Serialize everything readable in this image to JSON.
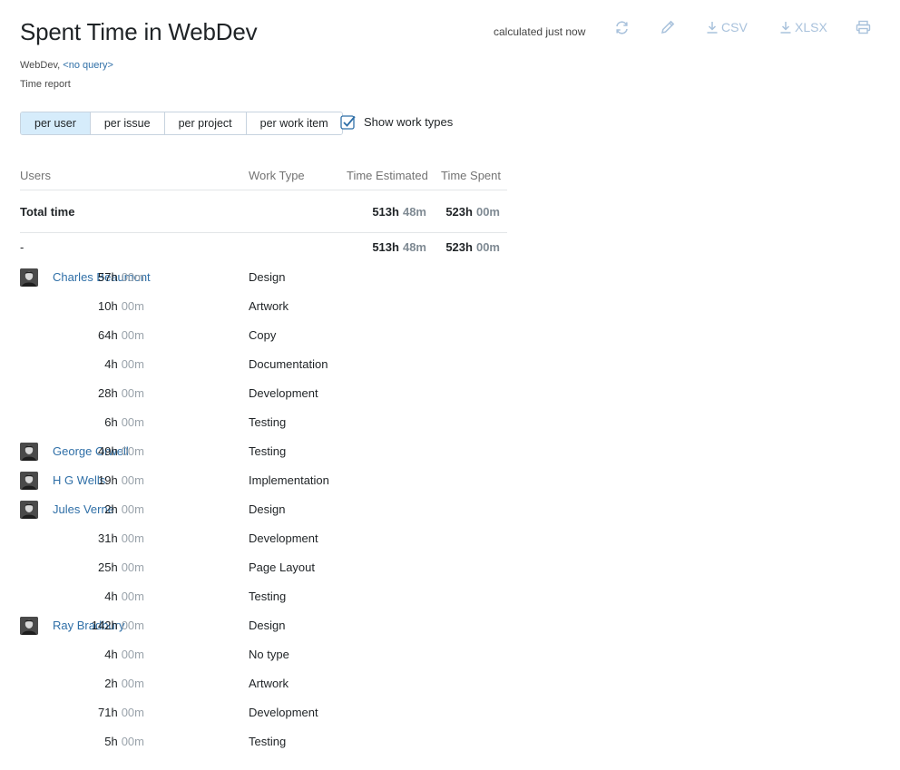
{
  "header": {
    "title": "Spent Time in WebDev",
    "calculated": "calculated just now",
    "csv_label": "CSV",
    "xlsx_label": "XLSX"
  },
  "context": {
    "project": "WebDev,",
    "query_link": "<no query>",
    "report_type": "Time report"
  },
  "grouping": {
    "buttons": [
      "per user",
      "per issue",
      "per project",
      "per work item"
    ],
    "active": "per user",
    "show_work_types_label": "Show work types",
    "show_work_types_checked": true
  },
  "table": {
    "columns": [
      "Users",
      "Work Type",
      "Time Estimated",
      "Time Spent"
    ],
    "total": {
      "label": "Total time",
      "estimated_h": "513h",
      "estimated_m": "48m",
      "spent_h": "523h",
      "spent_m": "00m"
    },
    "group": {
      "label": "-",
      "estimated_h": "513h",
      "estimated_m": "48m",
      "spent_h": "523h",
      "spent_m": "00m"
    },
    "rows": [
      {
        "user": "Charles Beaumont",
        "work_type": "Design",
        "spent_h": "57h",
        "spent_m": "00m"
      },
      {
        "user": "",
        "work_type": "Artwork",
        "spent_h": "10h",
        "spent_m": "00m"
      },
      {
        "user": "",
        "work_type": "Copy",
        "spent_h": "64h",
        "spent_m": "00m"
      },
      {
        "user": "",
        "work_type": "Documentation",
        "spent_h": "4h",
        "spent_m": "00m"
      },
      {
        "user": "",
        "work_type": "Development",
        "spent_h": "28h",
        "spent_m": "00m"
      },
      {
        "user": "",
        "work_type": "Testing",
        "spent_h": "6h",
        "spent_m": "00m"
      },
      {
        "user": "George Orwell",
        "work_type": "Testing",
        "spent_h": "49h",
        "spent_m": "00m"
      },
      {
        "user": "H G Wells",
        "work_type": "Implementation",
        "spent_h": "19h",
        "spent_m": "00m"
      },
      {
        "user": "Jules Verne",
        "work_type": "Design",
        "spent_h": "2h",
        "spent_m": "00m"
      },
      {
        "user": "",
        "work_type": "Development",
        "spent_h": "31h",
        "spent_m": "00m"
      },
      {
        "user": "",
        "work_type": "Page Layout",
        "spent_h": "25h",
        "spent_m": "00m"
      },
      {
        "user": "",
        "work_type": "Testing",
        "spent_h": "4h",
        "spent_m": "00m"
      },
      {
        "user": "Ray Bradbury",
        "work_type": "Design",
        "spent_h": "142h",
        "spent_m": "00m"
      },
      {
        "user": "",
        "work_type": "No type",
        "spent_h": "4h",
        "spent_m": "00m"
      },
      {
        "user": "",
        "work_type": "Artwork",
        "spent_h": "2h",
        "spent_m": "00m"
      },
      {
        "user": "",
        "work_type": "Development",
        "spent_h": "71h",
        "spent_m": "00m"
      },
      {
        "user": "",
        "work_type": "Testing",
        "spent_h": "5h",
        "spent_m": "00m"
      }
    ]
  },
  "icons": {
    "refresh": "refresh-icon",
    "edit": "pencil-icon",
    "download": "download-icon",
    "print": "printer-icon",
    "check": "checkbox-checked-icon",
    "avatar": "user-avatar-icon"
  },
  "colors": {
    "link": "#2f6fa7",
    "toolbar_icon": "#a9c2dc",
    "active_segment": "#d6ecfb",
    "muted_minutes": "#9aa3ab"
  }
}
